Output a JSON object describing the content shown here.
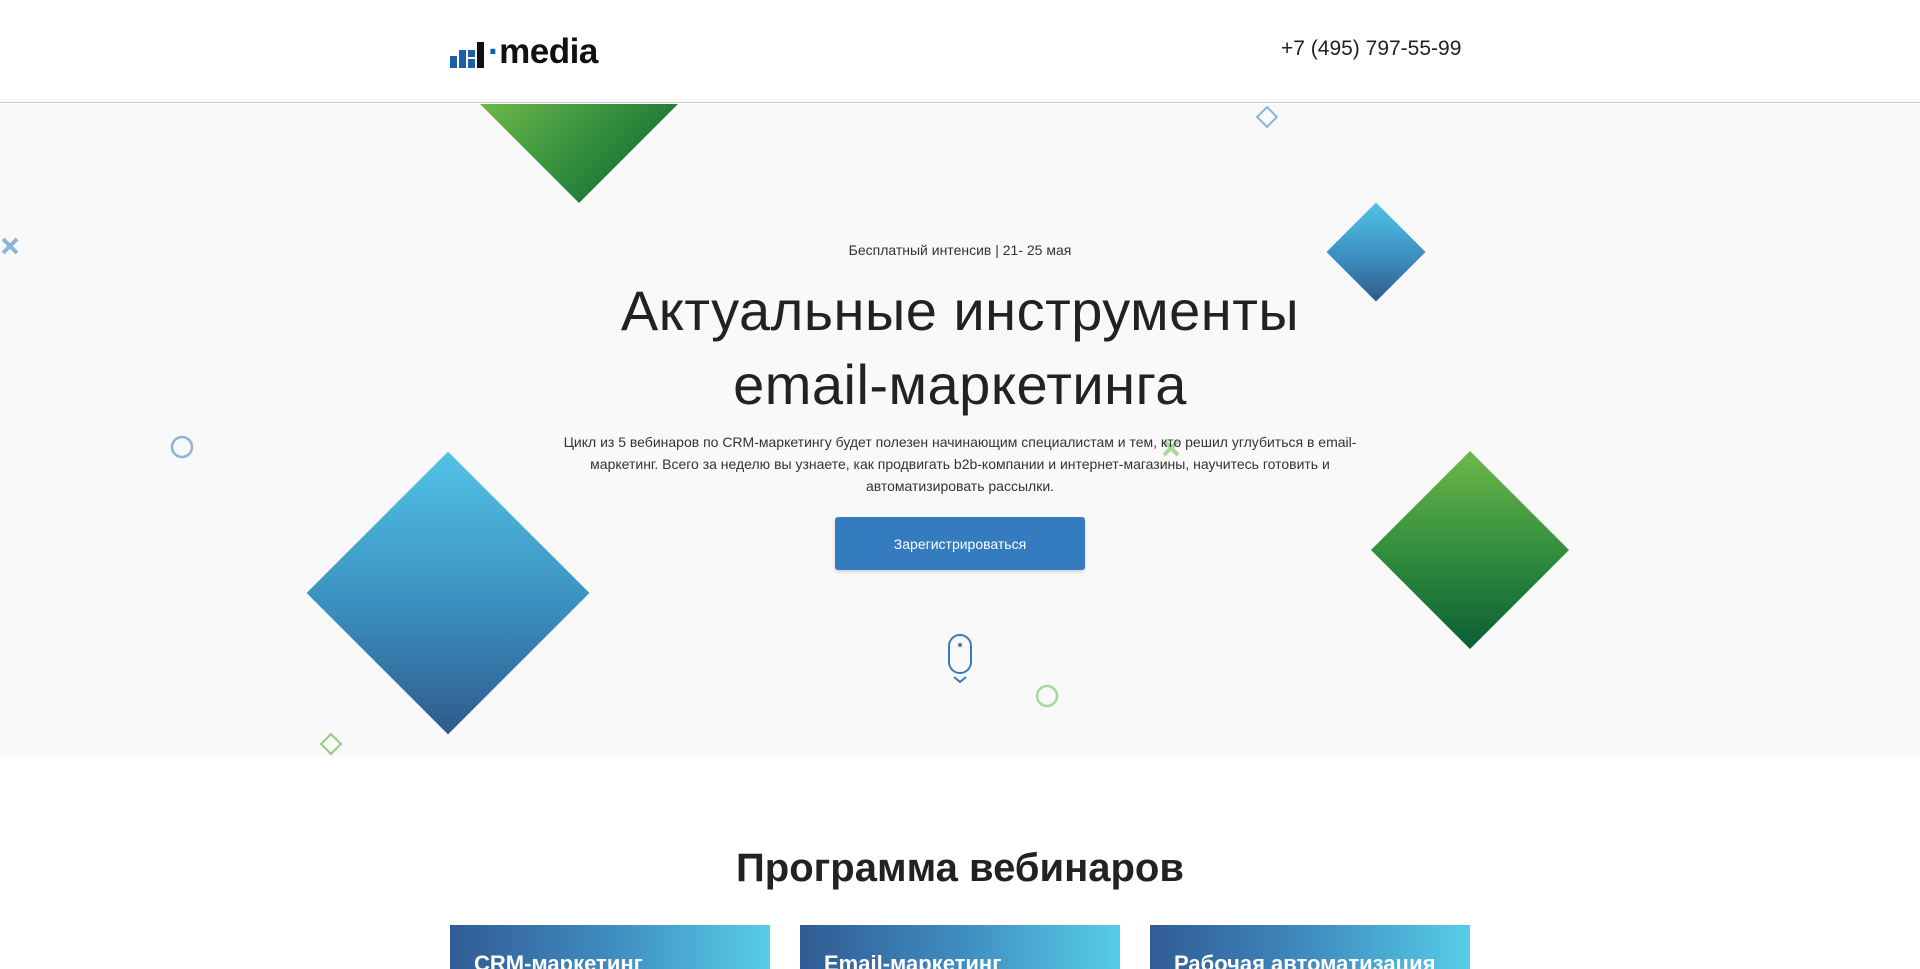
{
  "header": {
    "logo_mark": "i",
    "logo_separator": "·",
    "logo_word": "media",
    "phone": "+7 (495) 797-55-99"
  },
  "hero": {
    "eyebrow": "Бесплатный интенсив | 21- 25 мая",
    "title_line1": "Актуальные инструменты",
    "title_line2": "email-маркетинга",
    "description": "Цикл из 5 вебинаров по CRM-маркетингу будет полезен начинающим специалистам и тем, кто решил углубиться в email-маркетинг. Всего за неделю вы узнаете, как продвигать b2b-компании и интернет-магазины, научитесь готовить и автоматизировать рассылки.",
    "cta_label": "Зарегистрироваться",
    "scroll_icon": "mouse-scroll-icon"
  },
  "program": {
    "title": "Программа вебинаров",
    "cards": [
      {
        "title": "CRM-маркетинг"
      },
      {
        "title": "Email-маркетинг"
      },
      {
        "title": "Рабочая автоматизация"
      }
    ]
  },
  "colors": {
    "brand_blue": "#1b5fa6",
    "button_blue": "#357bc0",
    "green_dark": "#0b5e34",
    "green_light": "#6db84a",
    "blue_light": "#53c3e6",
    "blue_dark": "#2f5a8c",
    "hero_bg": "#f9f9f9"
  }
}
